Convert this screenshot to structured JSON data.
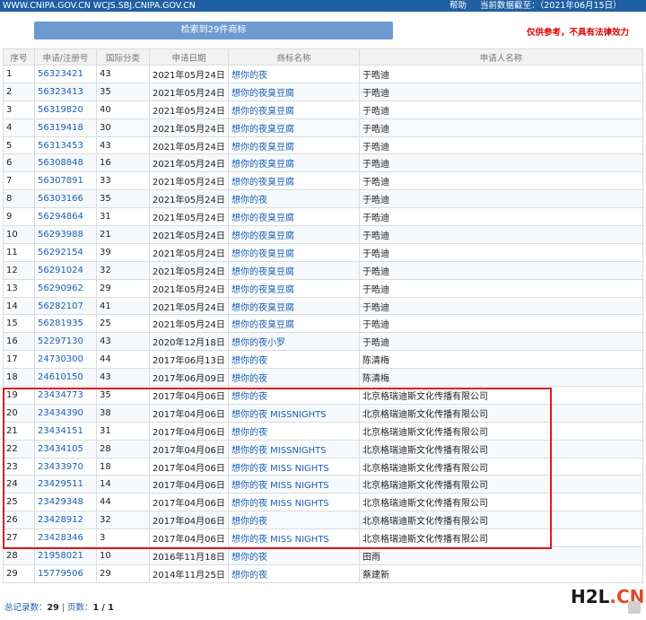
{
  "topbar": {
    "site_urls": "WWW.CNIPA.GOV.CN WCJS.SBJ.CNIPA.GOV.CN",
    "help": "帮助",
    "data_date": "当前数据截至：（2021年06月15日）"
  },
  "search_result_button": "检索到29件商标",
  "disclaimer": "仅供参考，不具有法律效力",
  "table": {
    "headers": [
      "序号",
      "申请/注册号",
      "国际分类",
      "申请日期",
      "商标名称",
      "申请人名称"
    ],
    "rows": [
      [
        "1",
        "56323421",
        "43",
        "2021年05月24日",
        "想你的夜",
        "于晧迪"
      ],
      [
        "2",
        "56323413",
        "35",
        "2021年05月24日",
        "想你的夜臭豆腐",
        "于晧迪"
      ],
      [
        "3",
        "56319820",
        "40",
        "2021年05月24日",
        "想你的夜臭豆腐",
        "于晧迪"
      ],
      [
        "4",
        "56319418",
        "30",
        "2021年05月24日",
        "想你的夜臭豆腐",
        "于晧迪"
      ],
      [
        "5",
        "56313453",
        "43",
        "2021年05月24日",
        "想你的夜臭豆腐",
        "于晧迪"
      ],
      [
        "6",
        "56308848",
        "16",
        "2021年05月24日",
        "想你的夜臭豆腐",
        "于晧迪"
      ],
      [
        "7",
        "56307891",
        "33",
        "2021年05月24日",
        "想你的夜臭豆腐",
        "于晧迪"
      ],
      [
        "8",
        "56303166",
        "35",
        "2021年05月24日",
        "想你的夜",
        "于晧迪"
      ],
      [
        "9",
        "56294864",
        "31",
        "2021年05月24日",
        "想你的夜臭豆腐",
        "于晧迪"
      ],
      [
        "10",
        "56293988",
        "21",
        "2021年05月24日",
        "想你的夜臭豆腐",
        "于晧迪"
      ],
      [
        "11",
        "56292154",
        "39",
        "2021年05月24日",
        "想你的夜臭豆腐",
        "于晧迪"
      ],
      [
        "12",
        "56291024",
        "32",
        "2021年05月24日",
        "想你的夜臭豆腐",
        "于晧迪"
      ],
      [
        "13",
        "56290962",
        "29",
        "2021年05月24日",
        "想你的夜臭豆腐",
        "于晧迪"
      ],
      [
        "14",
        "56282107",
        "41",
        "2021年05月24日",
        "想你的夜臭豆腐",
        "于晧迪"
      ],
      [
        "15",
        "56281935",
        "25",
        "2021年05月24日",
        "想你的夜臭豆腐",
        "于晧迪"
      ],
      [
        "16",
        "52297130",
        "43",
        "2020年12月18日",
        "想你的夜小罗",
        "于晧迪"
      ],
      [
        "17",
        "24730300",
        "44",
        "2017年06月13日",
        "想你的夜",
        "陈清梅"
      ],
      [
        "18",
        "24610150",
        "43",
        "2017年06月09日",
        "想你的夜",
        "陈清梅"
      ],
      [
        "19",
        "23434773",
        "35",
        "2017年04月06日",
        "想你的夜",
        "北京格瑞迪斯文化传播有限公司"
      ],
      [
        "20",
        "23434390",
        "38",
        "2017年04月06日",
        "想你的夜 MISSNIGHTS",
        "北京格瑞迪斯文化传播有限公司"
      ],
      [
        "21",
        "23434151",
        "31",
        "2017年04月06日",
        "想你的夜",
        "北京格瑞迪斯文化传播有限公司"
      ],
      [
        "22",
        "23434105",
        "28",
        "2017年04月06日",
        "想你的夜 MISSNIGHTS",
        "北京格瑞迪斯文化传播有限公司"
      ],
      [
        "23",
        "23433970",
        "18",
        "2017年04月06日",
        "想你的夜 MISS NIGHTS",
        "北京格瑞迪斯文化传播有限公司"
      ],
      [
        "24",
        "23429511",
        "14",
        "2017年04月06日",
        "想你的夜 MISS NIGHTS",
        "北京格瑞迪斯文化传播有限公司"
      ],
      [
        "25",
        "23429348",
        "44",
        "2017年04月06日",
        "想你的夜 MISS NIGHTS",
        "北京格瑞迪斯文化传播有限公司"
      ],
      [
        "26",
        "23428912",
        "32",
        "2017年04月06日",
        "想你的夜",
        "北京格瑞迪斯文化传播有限公司"
      ],
      [
        "27",
        "23428346",
        "3",
        "2017年04月06日",
        "想你的夜 MISS NIGHTS",
        "北京格瑞迪斯文化传播有限公司"
      ],
      [
        "28",
        "21958021",
        "10",
        "2016年11月18日",
        "想你的夜",
        "田雨"
      ],
      [
        "29",
        "15779506",
        "29",
        "2014年11月25日",
        "想你的夜",
        "蔡建新"
      ]
    ]
  },
  "footer": {
    "total_label": "总记录数：",
    "total_value": "29",
    "separator": " | ",
    "pages_label": "页数：",
    "pages_value": "1 / 1"
  },
  "watermark": {
    "part1": "H2L",
    "part2": ".CN"
  },
  "colors": {
    "topbar": "#1f5fa3",
    "link": "#1a5fb4",
    "highlight_border": "#e0191e",
    "disclaimer": "#e00000"
  }
}
